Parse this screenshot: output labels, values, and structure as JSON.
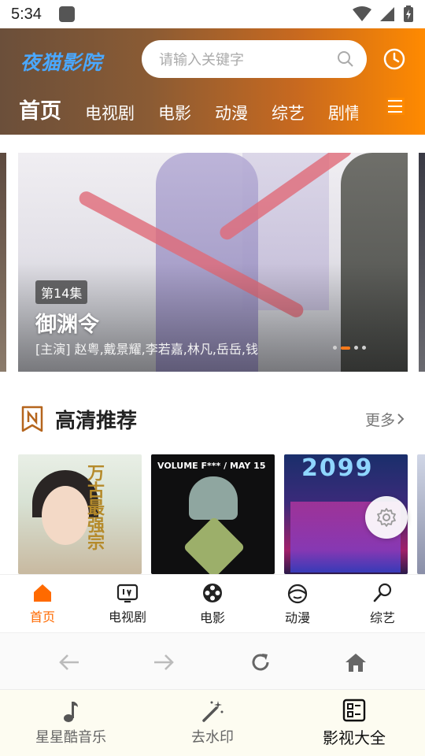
{
  "status_bar": {
    "time": "5:34"
  },
  "header": {
    "logo": "夜猫影院",
    "search": {
      "placeholder": "请输入关键字"
    },
    "nav_tabs": [
      "首页",
      "电视剧",
      "电影",
      "动漫",
      "综艺",
      "剧情"
    ],
    "active_tab": "首页"
  },
  "banner": {
    "episode": "第14集",
    "title": "御渊令",
    "cast": "[主演] 赵粤,戴景耀,李若嘉,林凡,岳岳,钱",
    "dots_count": 4,
    "active_dot": 1
  },
  "section": {
    "title": "高清推荐",
    "more": "更多"
  },
  "posters": {
    "p1_art_text": "万古最强宗",
    "p2_header": "VOLUME F*** / MAY 15",
    "p3_title": "2099"
  },
  "app_nav": [
    {
      "label": "首页",
      "icon": "home-icon"
    },
    {
      "label": "电视剧",
      "icon": "tv-icon"
    },
    {
      "label": "电影",
      "icon": "film-reel-icon"
    },
    {
      "label": "动漫",
      "icon": "anime-icon"
    },
    {
      "label": "综艺",
      "icon": "microphone-icon"
    }
  ],
  "host_tabs": [
    {
      "label": "星星酷音乐",
      "icon": "music-note-icon"
    },
    {
      "label": "去水印",
      "icon": "magic-wand-icon"
    },
    {
      "label": "影视大全",
      "icon": "grid-list-icon"
    }
  ],
  "colors": {
    "accent": "#ff6a00",
    "logo": "#4aa8ff",
    "header_start": "#6b4f3a",
    "header_end": "#ff8a00"
  }
}
